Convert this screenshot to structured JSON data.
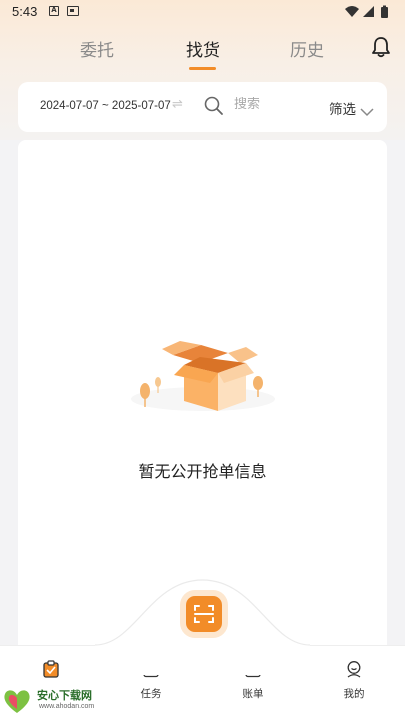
{
  "status_bar": {
    "time": "5:43",
    "left_icons": [
      "notification-a-icon",
      "sim-card-icon"
    ],
    "right_icons": [
      "wifi-icon",
      "signal-icon",
      "battery-icon"
    ]
  },
  "tabs": [
    {
      "label": "委托",
      "active": false
    },
    {
      "label": "找货",
      "active": true
    },
    {
      "label": "历史",
      "active": false
    }
  ],
  "header": {
    "bell_icon": "bell-icon"
  },
  "filter": {
    "date_range": "2024-07-07 ~ 2025-07-07",
    "search_placeholder": "搜索",
    "filter_label": "筛选"
  },
  "empty_state": {
    "message": "暂无公开抢单信息",
    "illustration": "open-box-illustration"
  },
  "scan_button": {
    "icon": "scan-icon"
  },
  "bottom_nav": [
    {
      "label": "",
      "icon": "clipboard-icon",
      "active": true
    },
    {
      "label": "任务",
      "icon": "task-list-icon",
      "active": false
    },
    {
      "label": "账单",
      "icon": "bill-yen-icon",
      "active": false
    },
    {
      "label": "我的",
      "icon": "user-icon",
      "active": false
    }
  ],
  "watermark": {
    "title": "安心下载网",
    "url": "www.ahodan.com"
  },
  "colors": {
    "accent": "#f28c28",
    "accent_light": "#fde7cf",
    "header_bg": "#fbe9d6"
  }
}
